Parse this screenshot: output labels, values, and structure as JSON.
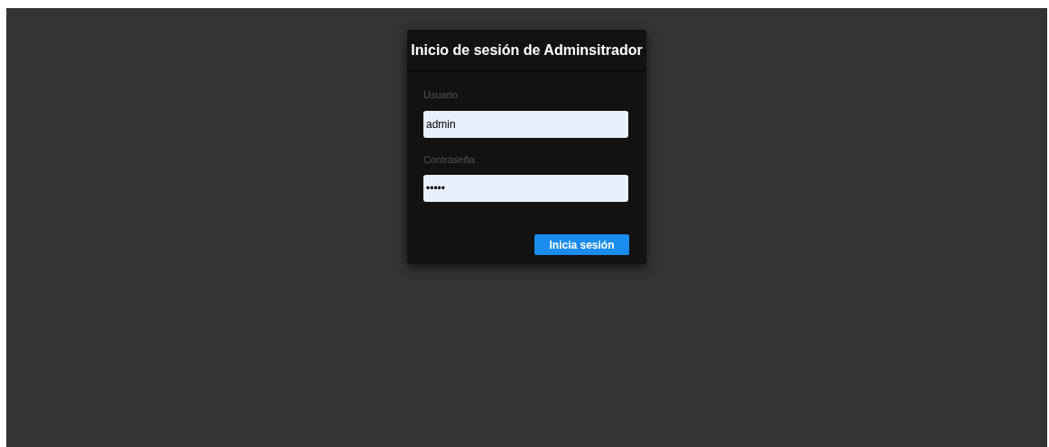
{
  "login": {
    "title": "Inicio de sesión de Adminsitrador",
    "fields": [
      {
        "label": "Usuario",
        "value": "admin"
      },
      {
        "label": "Contraseña",
        "value": "•••••"
      }
    ],
    "button": "Inicia sesión"
  }
}
